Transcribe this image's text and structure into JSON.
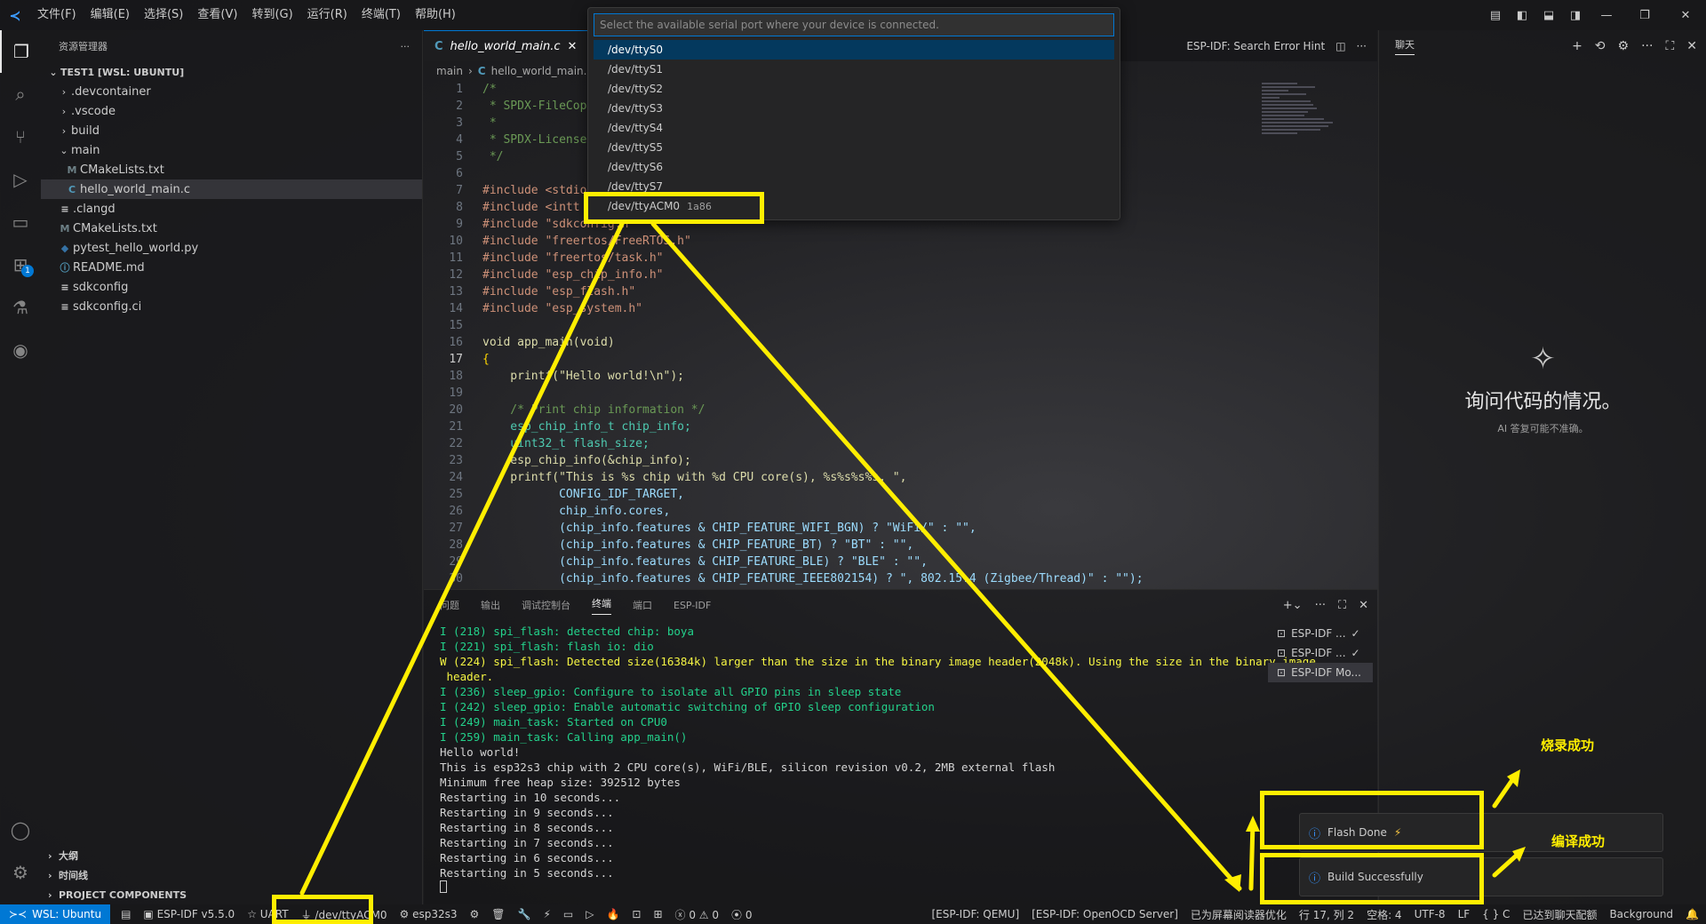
{
  "menu": [
    "文件(F)",
    "编辑(E)",
    "选择(S)",
    "查看(V)",
    "转到(G)",
    "运行(R)",
    "终端(T)",
    "帮助(H)"
  ],
  "sidebar": {
    "title": "资源管理器",
    "root": "TEST1 [WSL: UBUNTU]",
    "items": [
      {
        "label": ".devcontainer",
        "type": "folder"
      },
      {
        "label": ".vscode",
        "type": "folder"
      },
      {
        "label": "build",
        "type": "folder"
      },
      {
        "label": "main",
        "type": "folder-open"
      },
      {
        "label": "CMakeLists.txt",
        "type": "cmake"
      },
      {
        "label": "hello_world_main.c",
        "type": "c"
      },
      {
        "label": ".clangd",
        "type": "text"
      },
      {
        "label": "CMakeLists.txt",
        "type": "cmake"
      },
      {
        "label": "pytest_hello_world.py",
        "type": "python"
      },
      {
        "label": "README.md",
        "type": "info"
      },
      {
        "label": "sdkconfig",
        "type": "text"
      },
      {
        "label": "sdkconfig.ci",
        "type": "text"
      }
    ],
    "sections": [
      "大纲",
      "时间线",
      "PROJECT COMPONENTS"
    ]
  },
  "editor": {
    "tab_label": "hello_world_main.c",
    "hint_label": "ESP-IDF: Search Error Hint",
    "breadcrumb": [
      "main",
      "hello_world_main."
    ],
    "lines": [
      {
        "n": "1",
        "t": "/*"
      },
      {
        "n": "2",
        "t": " * SPDX-FileCop"
      },
      {
        "n": "3",
        "t": " *"
      },
      {
        "n": "4",
        "t": " * SPDX-License"
      },
      {
        "n": "5",
        "t": " */"
      },
      {
        "n": "6",
        "t": ""
      },
      {
        "n": "7",
        "t": "#include <stdio"
      },
      {
        "n": "8",
        "t": "#include <intt"
      },
      {
        "n": "9",
        "t": "#include \"sdkconfig.h\""
      },
      {
        "n": "10",
        "t": "#include \"freertos/FreeRTOS.h\""
      },
      {
        "n": "11",
        "t": "#include \"freertos/task.h\""
      },
      {
        "n": "12",
        "t": "#include \"esp_chip_info.h\""
      },
      {
        "n": "13",
        "t": "#include \"esp_flash.h\""
      },
      {
        "n": "14",
        "t": "#include \"esp_system.h\""
      },
      {
        "n": "15",
        "t": ""
      },
      {
        "n": "16",
        "t": "void app_main(void)"
      },
      {
        "n": "17",
        "t": "{"
      },
      {
        "n": "18",
        "t": "    printf(\"Hello world!\\n\");"
      },
      {
        "n": "19",
        "t": ""
      },
      {
        "n": "20",
        "t": "    /* Print chip information */"
      },
      {
        "n": "21",
        "t": "    esp_chip_info_t chip_info;"
      },
      {
        "n": "22",
        "t": "    uint32_t flash_size;"
      },
      {
        "n": "23",
        "t": "    esp_chip_info(&chip_info);"
      },
      {
        "n": "24",
        "t": "    printf(\"This is %s chip with %d CPU core(s), %s%s%s%s, \","
      },
      {
        "n": "25",
        "t": "           CONFIG_IDF_TARGET,"
      },
      {
        "n": "26",
        "t": "           chip_info.cores,"
      },
      {
        "n": "27",
        "t": "           (chip_info.features & CHIP_FEATURE_WIFI_BGN) ? \"WiFi/\" : \"\","
      },
      {
        "n": "28",
        "t": "           (chip_info.features & CHIP_FEATURE_BT) ? \"BT\" : \"\","
      },
      {
        "n": "29",
        "t": "           (chip_info.features & CHIP_FEATURE_BLE) ? \"BLE\" : \"\","
      },
      {
        "n": "30",
        "t": "           (chip_info.features & CHIP_FEATURE_IEEE802154) ? \", 802.15.4 (Zigbee/Thread)\" : \"\");"
      }
    ]
  },
  "quickpick": {
    "placeholder": "Select the available serial port where your device is connected.",
    "items": [
      {
        "label": "/dev/ttyS0",
        "desc": ""
      },
      {
        "label": "/dev/ttyS1",
        "desc": ""
      },
      {
        "label": "/dev/ttyS2",
        "desc": ""
      },
      {
        "label": "/dev/ttyS3",
        "desc": ""
      },
      {
        "label": "/dev/ttyS4",
        "desc": ""
      },
      {
        "label": "/dev/ttyS5",
        "desc": ""
      },
      {
        "label": "/dev/ttyS6",
        "desc": ""
      },
      {
        "label": "/dev/ttyS7",
        "desc": ""
      },
      {
        "label": "/dev/ttyACM0",
        "desc": "1a86"
      }
    ]
  },
  "panel": {
    "tabs": [
      "问题",
      "输出",
      "调试控制台",
      "终端",
      "端口",
      "ESP-IDF"
    ],
    "active_tab": "终端",
    "terminal_lines": [
      {
        "t": "I (218) spi_flash: detected chip: boya",
        "c": "green"
      },
      {
        "t": "I (221) spi_flash: flash io: dio",
        "c": "green"
      },
      {
        "t": "W (224) spi_flash: Detected size(16384k) larger than the size in the binary image header(2048k). Using the size in the binary image",
        "c": "yellow"
      },
      {
        "t": " header.",
        "c": "yellow"
      },
      {
        "t": "I (236) sleep_gpio: Configure to isolate all GPIO pins in sleep state",
        "c": "green"
      },
      {
        "t": "I (242) sleep_gpio: Enable automatic switching of GPIO sleep configuration",
        "c": "green"
      },
      {
        "t": "I (249) main_task: Started on CPU0",
        "c": "green"
      },
      {
        "t": "I (259) main_task: Calling app_main()",
        "c": "green"
      },
      {
        "t": "Hello world!",
        "c": "white"
      },
      {
        "t": "This is esp32s3 chip with 2 CPU core(s), WiFi/BLE, silicon revision v0.2, 2MB external flash",
        "c": "white"
      },
      {
        "t": "Minimum free heap size: 392512 bytes",
        "c": "white"
      },
      {
        "t": "Restarting in 10 seconds...",
        "c": "white"
      },
      {
        "t": "Restarting in 9 seconds...",
        "c": "white"
      },
      {
        "t": "Restarting in 8 seconds...",
        "c": "white"
      },
      {
        "t": "Restarting in 7 seconds...",
        "c": "white"
      },
      {
        "t": "Restarting in 6 seconds...",
        "c": "white"
      },
      {
        "t": "Restarting in 5 seconds...",
        "c": "white"
      }
    ],
    "terminals": [
      {
        "label": "ESP-IDF ...",
        "check": "✓"
      },
      {
        "label": "ESP-IDF ...",
        "check": "✓"
      },
      {
        "label": "ESP-IDF Mo...",
        "check": ""
      }
    ]
  },
  "chat": {
    "title": "聊天",
    "heading": "询问代码的情况。",
    "sub": "AI 答复可能不准确。"
  },
  "notifications": {
    "flash": "Flash Done",
    "build": "Build Successfully"
  },
  "annotations": {
    "flash_cn": "烧录成功",
    "build_cn": "编译成功"
  },
  "statusbar": {
    "remote": "WSL: Ubuntu",
    "left": [
      "ESP-IDF v5.5.0",
      "UART",
      "/dev/ttyACM0",
      "esp32s3"
    ],
    "problems": "0 ⚠ 0",
    "ports": "0",
    "right": [
      "[ESP-IDF: QEMU]",
      "[ESP-IDF: OpenOCD Server]",
      "已为屏幕阅读器优化",
      "行 17, 列 2",
      "空格: 4",
      "UTF-8",
      "LF",
      "{ } C",
      "已达到聊天配额",
      "Background"
    ]
  },
  "colors": {
    "accent": "#0078d4",
    "annotation": "#ffee00"
  }
}
